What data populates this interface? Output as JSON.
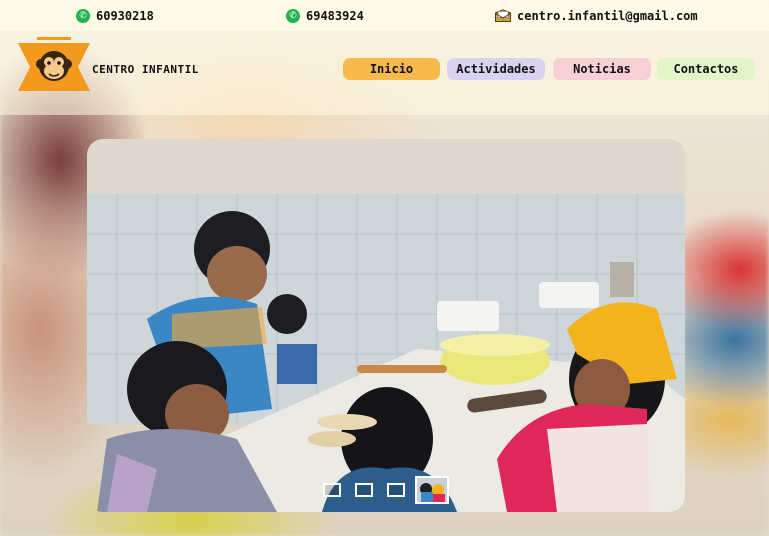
{
  "contacts": {
    "phone1": "60930218",
    "phone2": "69483924",
    "email": "centro.infantil@gmail.com",
    "phone_icon": "whatsapp-icon",
    "email_icon": "mail-icon"
  },
  "brand": {
    "name": "CENTRO INFANTIL",
    "logo_icon": "monkey-logo-icon"
  },
  "nav": {
    "items": [
      {
        "label": "Inicio",
        "color": "#f6b94c"
      },
      {
        "label": "Actividades",
        "color": "#d9d3f1"
      },
      {
        "label": "Noticias",
        "color": "#f7cfd6"
      },
      {
        "label": "Contactos",
        "color": "#e2f5c8"
      }
    ]
  },
  "slider": {
    "slide_count": 4,
    "active_index": 3
  }
}
